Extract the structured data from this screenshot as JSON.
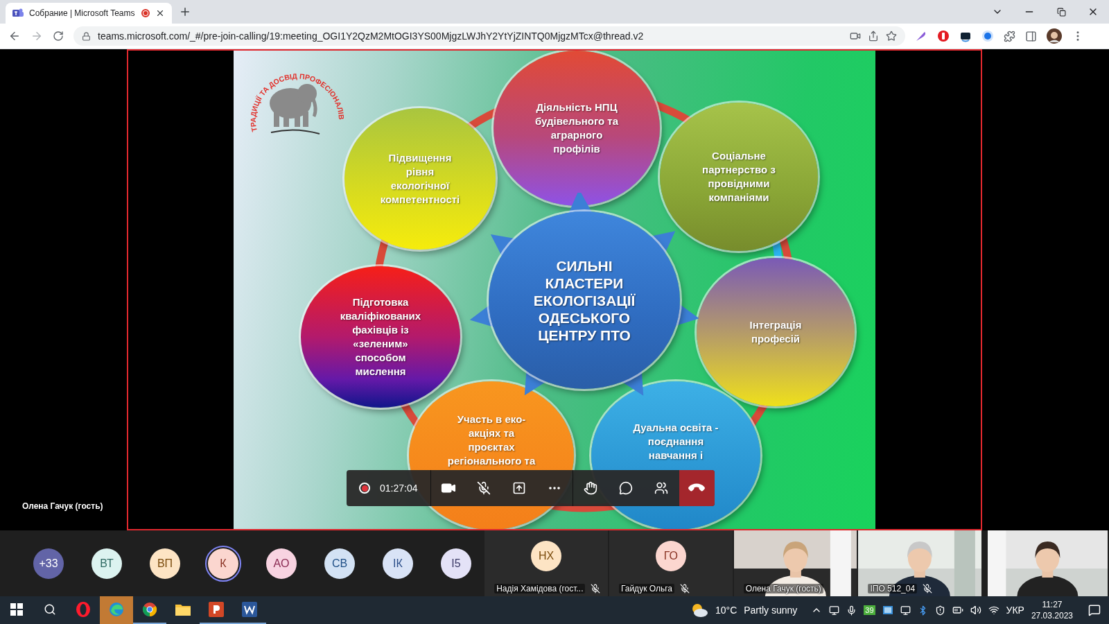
{
  "browser": {
    "tab": {
      "title": "Собрание | Microsoft Teams",
      "recording": true
    },
    "url": "teams.microsoft.com/_#/pre-join-calling/19:meeting_OGI1Y2QzM2MtOGI3YS00MjgzLWJhY2YtYjZINTQ0MjgzMTcx@thread.v2"
  },
  "stage": {
    "presenter": "Олена Гачук (гость)",
    "slide": {
      "logo_text": "ТРАДИЦІЇ ТА ДОСВІД ПРОФЕСІОНАЛІВ",
      "center": "СИЛЬНІ\nКЛАСТЕРИ\nЕКОЛОГІЗАЦІЇ\nОДЕСЬКОГО\nЦЕНТРУ ПТО",
      "clusters": [
        {
          "text": "Діяльність НПЦ\nбудівельного та\nаграрного\nпрофілів"
        },
        {
          "text": "Підвищення\nрівня\nекологічної\nкомпетентності"
        },
        {
          "text": "Соціальне\nпартнерство з\nпровідними\nкомпаніями"
        },
        {
          "text": "Підготовка\nкваліфікованих\nфахівців із\n«зеленим»\nспособом\nмислення"
        },
        {
          "text": "Інтеграція\nпрофесій"
        },
        {
          "text": "Участь в еко-\nакціях та\nпроєктах\nрегіонального та"
        },
        {
          "text": "Дуальна освіта -\nпоєднання\nнавчання і"
        }
      ]
    }
  },
  "call_controls": {
    "recording": true,
    "timer": "01:27:04",
    "mic_muted": true
  },
  "participants": [
    {
      "kind": "overflow",
      "initials": "+33",
      "speaking": false
    },
    {
      "kind": "avatar",
      "initials": "ВТ",
      "speaking": false
    },
    {
      "kind": "avatar",
      "initials": "ВП",
      "speaking": false
    },
    {
      "kind": "avatar",
      "initials": "К",
      "speaking": true
    },
    {
      "kind": "avatar",
      "initials": "АО",
      "speaking": false
    },
    {
      "kind": "avatar",
      "initials": "СВ",
      "speaking": false
    },
    {
      "kind": "avatar",
      "initials": "ІК",
      "speaking": false
    },
    {
      "kind": "avatar",
      "initials": "І5",
      "speaking": false
    }
  ],
  "tiles": [
    {
      "kind": "avatar",
      "initials": "НХ",
      "name": "Надія Хамідова (гост...",
      "muted": true
    },
    {
      "kind": "avatar",
      "initials": "ГО",
      "name": "Гайдук Ольга",
      "muted": true
    },
    {
      "kind": "video",
      "name": "Олена Гачук (гость)",
      "muted": false
    },
    {
      "kind": "video",
      "name": "ІПО 512_04",
      "muted": true
    },
    {
      "kind": "video"
    }
  ],
  "taskbar": {
    "apps": [
      {
        "kind": "search",
        "open": false,
        "flashing": false
      },
      {
        "kind": "opera",
        "open": false,
        "flashing": false
      },
      {
        "kind": "edge",
        "open": false,
        "flashing": true
      },
      {
        "kind": "chrome",
        "open": true,
        "flashing": false
      },
      {
        "kind": "explorer",
        "open": false,
        "flashing": false
      },
      {
        "kind": "powerpoint",
        "open": true,
        "flashing": false
      },
      {
        "kind": "word",
        "open": true,
        "flashing": false
      }
    ],
    "temperature": "10°C",
    "weather": "Partly sunny",
    "badge": "39",
    "language": "УКР",
    "time": "11:27",
    "date": "27.03.2023"
  }
}
